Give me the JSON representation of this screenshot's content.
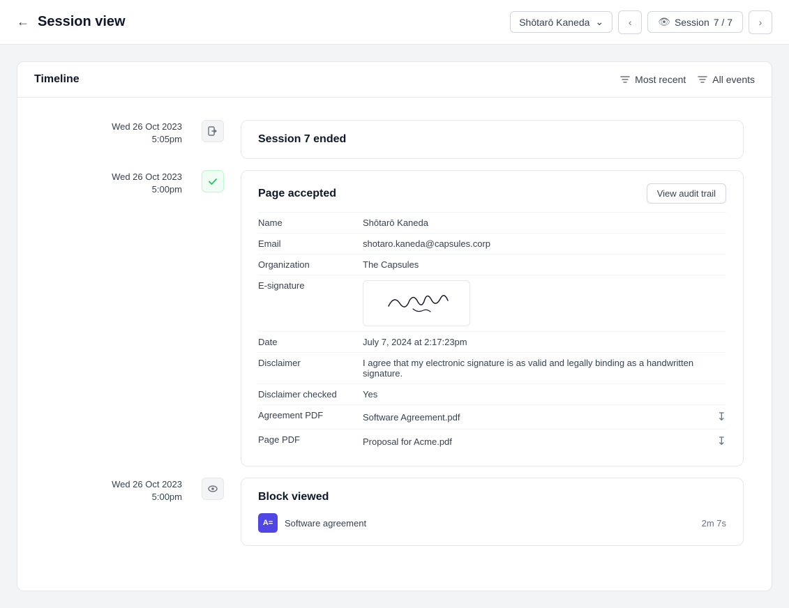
{
  "header": {
    "back_label": "←",
    "title": "Session view",
    "user_name": "Shōtarō Kaneda",
    "session_label": "Session",
    "session_current": "7 / 7"
  },
  "timeline": {
    "title": "Timeline",
    "filter_recent": "Most recent",
    "filter_all": "All events"
  },
  "events": [
    {
      "id": "session-ended",
      "date": "Wed 26 Oct 2023",
      "time": "5:05pm",
      "icon_type": "exit",
      "title": "Session 7 ended"
    },
    {
      "id": "page-accepted",
      "date": "Wed 26 Oct 2023",
      "time": "5:00pm",
      "icon_type": "check",
      "title": "Page accepted",
      "audit_btn": "View audit trail",
      "fields": [
        {
          "label": "Name",
          "value": "Shōtarō Kaneda"
        },
        {
          "label": "Email",
          "value": "shotaro.kaneda@capsules.corp"
        },
        {
          "label": "Organization",
          "value": "The Capsules"
        },
        {
          "label": "E-signature",
          "value": "signature"
        },
        {
          "label": "Date",
          "value": "July 7, 2024 at 2:17:23pm"
        },
        {
          "label": "Disclaimer",
          "value": "I agree that my electronic signature is as valid and legally binding as a handwritten signature."
        },
        {
          "label": "Disclaimer checked",
          "value": "Yes"
        },
        {
          "label": "Agreement PDF",
          "value": "Software Agreement.pdf"
        },
        {
          "label": "Page PDF",
          "value": "Proposal for Acme.pdf"
        }
      ]
    },
    {
      "id": "block-viewed",
      "date": "Wed 26 Oct 2023",
      "time": "5:00pm",
      "icon_type": "eye",
      "title": "Block viewed",
      "block_name": "Software agreement",
      "block_duration": "2m 7s",
      "block_icon": "A="
    }
  ]
}
